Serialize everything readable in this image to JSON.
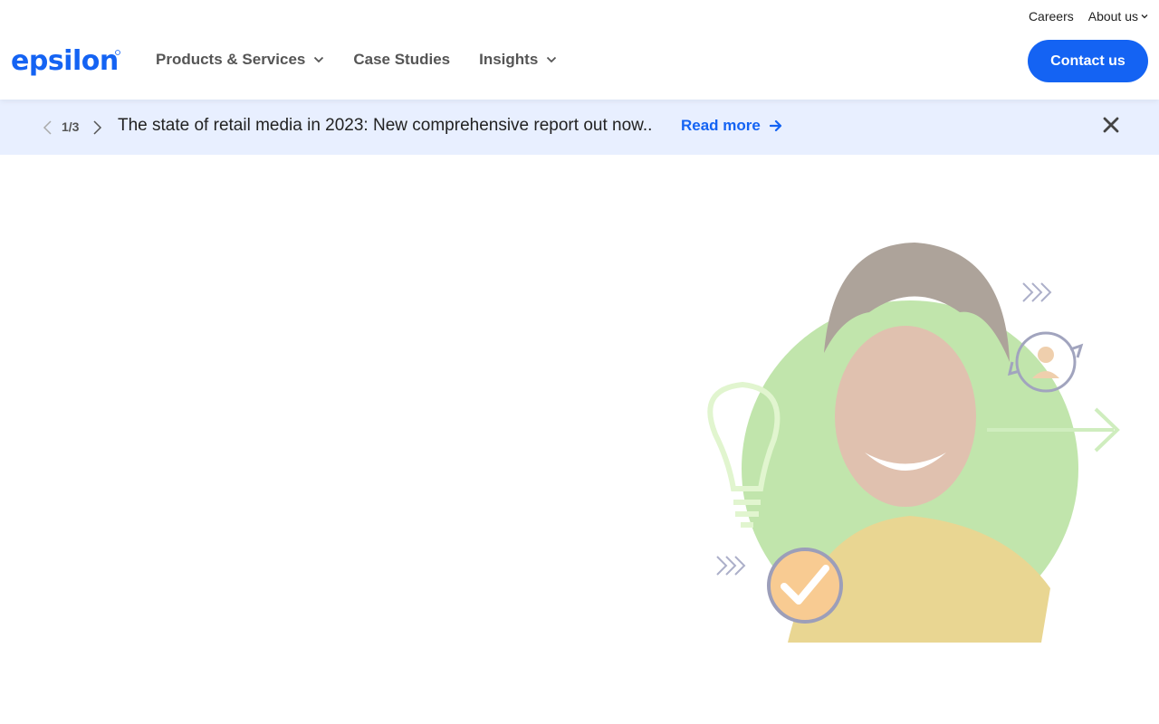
{
  "utility_nav": {
    "careers": "Careers",
    "about": "About us"
  },
  "brand": {
    "logo_text": "Epsilon",
    "color": "#1463f3"
  },
  "main_nav": [
    {
      "label": "Products & Services",
      "has_dropdown": true
    },
    {
      "label": "Case Studies",
      "has_dropdown": false
    },
    {
      "label": "Insights",
      "has_dropdown": true
    }
  ],
  "contact_button": {
    "label": "Contact us"
  },
  "banner": {
    "counter": "1/3",
    "headline": "The state of retail media in 2023: New comprehensive report out now..",
    "read_more": "Read more",
    "background": "#e8efff"
  },
  "hero": {
    "icons": [
      "lightbulb-icon",
      "checkmark-icon",
      "person-refresh-icon",
      "arrow-right-icon",
      "chevrons-icon"
    ]
  }
}
